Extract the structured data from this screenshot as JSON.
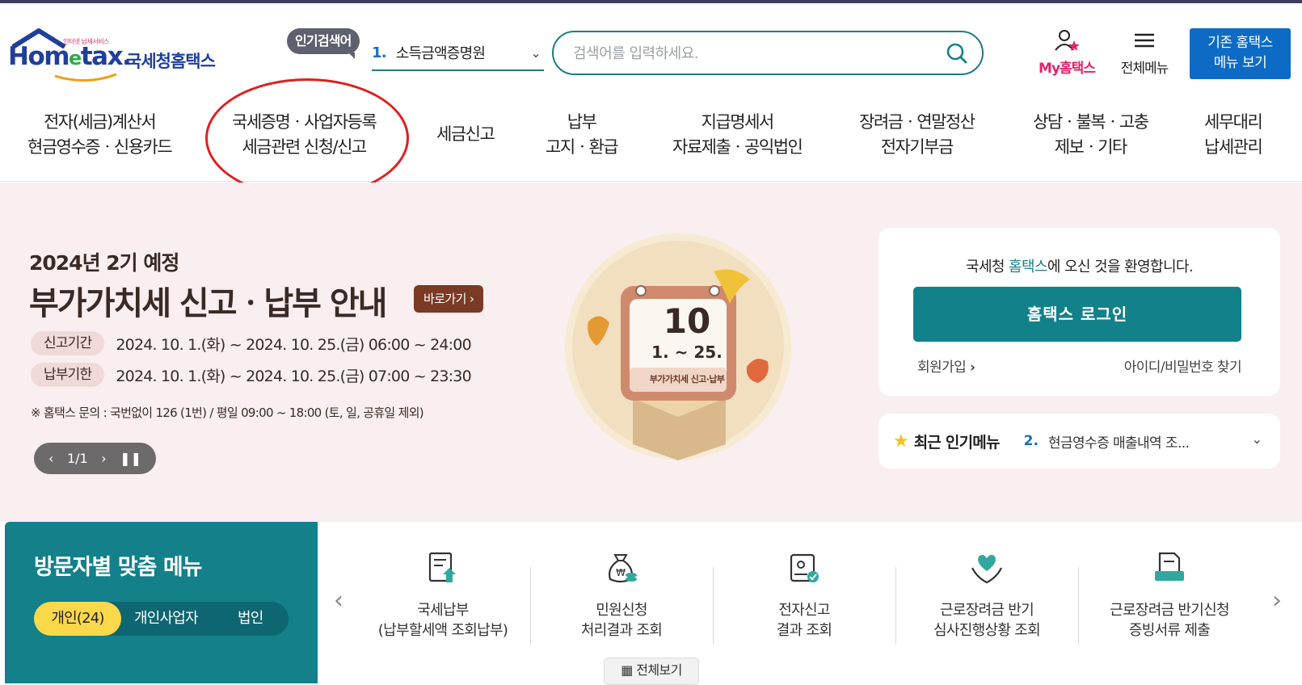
{
  "header": {
    "logo_tagline": "인터넷 납세서비스",
    "logo_word_pre": "Hom",
    "logo_word_e": "e",
    "logo_word_post": "tax.",
    "logo_korean": "국세청홈택스",
    "popular_badge": "인기검색어",
    "popular_num": "1.",
    "popular_term": "소득금액증명원",
    "search_placeholder": "검색어를 입력하세요.",
    "my_hometax": "My홈택스",
    "all_menu": "전체메뉴",
    "legacy_line1": "기존 홈택스",
    "legacy_line2": "메뉴 보기"
  },
  "nav": [
    {
      "l1": "전자(세금)계산서",
      "l2": "현금영수증ㆍ신용카드"
    },
    {
      "l1": "국세증명ㆍ사업자등록",
      "l2": "세금관련 신청/신고"
    },
    {
      "l1": "세금신고",
      "l2": ""
    },
    {
      "l1": "납부",
      "l2": "고지ㆍ환급"
    },
    {
      "l1": "지급명세서",
      "l2": "자료제출ㆍ공익법인"
    },
    {
      "l1": "장려금ㆍ연말정산",
      "l2": "전자기부금"
    },
    {
      "l1": "상담ㆍ불복ㆍ고충",
      "l2": "제보ㆍ기타"
    },
    {
      "l1": "세무대리",
      "l2": "납세관리"
    }
  ],
  "hero": {
    "subtitle": "2024년 2기 예정",
    "title": "부가가치세 신고ㆍ납부 안내",
    "go_button": "바로가기",
    "period1_label": "신고기간",
    "period1_text": "2024. 10. 1.(화) ~ 2024. 10. 25.(금) 06:00 ~ 24:00",
    "period2_label": "납부기한",
    "period2_text": "2024. 10. 1.(화) ~ 2024. 10. 25.(금) 07:00 ~ 23:30",
    "note": "※ 홈택스 문의 : 국번없이 126 (1번) / 평일 09:00 ~ 18:00 (토, 일, 공휴일 제외)",
    "pager": "1/1",
    "calendar_day": "10",
    "calendar_range": "1. ~ 25.",
    "calendar_caption": "부가가치세 신고·납부"
  },
  "login": {
    "welcome_pre": "국세청 ",
    "welcome_hl": "홈택스",
    "welcome_post": "에 오신 것을 환영합니다.",
    "login_button": "홈택스 로그인",
    "join": "회원가입",
    "find_id": "아이디/비밀번호 찾기"
  },
  "popular_menu": {
    "title": "최근 인기메뉴",
    "num": "2.",
    "item": "현금영수증 매출내역 조..."
  },
  "visitor_menu": {
    "title": "방문자별 맞춤 메뉴",
    "tabs": [
      "개인(24)",
      "개인사업자",
      "법인"
    ]
  },
  "quick_menu": {
    "items": [
      {
        "l1": "국세납부",
        "l2": "(납부할세액 조회납부)",
        "icon": "tax-payment-icon"
      },
      {
        "l1": "민원신청",
        "l2": "처리결과 조회",
        "icon": "money-bag-icon"
      },
      {
        "l1": "전자신고",
        "l2": "결과 조회",
        "icon": "electronic-filing-icon"
      },
      {
        "l1": "근로장려금 반기",
        "l2": "심사진행상황 조회",
        "icon": "heart-hands-icon"
      },
      {
        "l1": "근로장려금 반기신청",
        "l2": "증빙서류 제출",
        "icon": "document-submit-icon"
      }
    ],
    "view_all": "전체보기"
  },
  "colors": {
    "brand_teal": "#13818a",
    "brand_blue": "#1f3f9b",
    "legacy_blue": "#0d6bc6",
    "accent_pink": "#e0246a",
    "hero_bg": "#f9eef0",
    "highlight_circle": "#e01e1e"
  }
}
